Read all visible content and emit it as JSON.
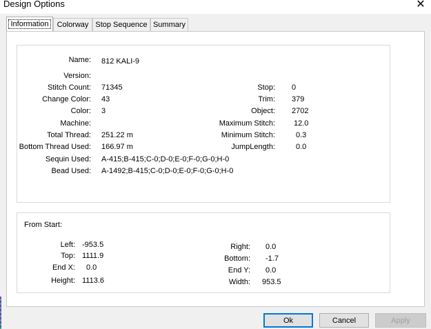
{
  "window": {
    "title": "Design Options",
    "close_glyph": "✕"
  },
  "tabs": [
    {
      "label": "Information",
      "active": true
    },
    {
      "label": "Colorway",
      "active": false
    },
    {
      "label": "Stop Sequence",
      "active": false
    },
    {
      "label": "Summary",
      "active": false
    }
  ],
  "info": {
    "name_label": "Name:",
    "name": "812 KALI-9",
    "version_label": "Version:",
    "version": "",
    "stitch_count_label": "Stitch Count:",
    "stitch_count": "71345",
    "change_color_label": "Change Color:",
    "change_color": "43",
    "color_label": "Color:",
    "color": "3",
    "machine_label": "Machine:",
    "machine": "",
    "total_thread_label": "Total Thread:",
    "total_thread": "251.22 m",
    "bottom_thread_label": "Bottom Thread Used:",
    "bottom_thread": "166.97 m",
    "sequin_label": "Sequin Used:",
    "sequin": "A-415;B-415;C-0;D-0;E-0;F-0;G-0;H-0",
    "bead_label": "Bead Used:",
    "bead": "A-1492;B-415;C-0;D-0;E-0;F-0;G-0;H-0",
    "stop_label": "Stop:",
    "stop": "0",
    "trim_label": "Trim:",
    "trim": "379",
    "object_label": "Object:",
    "object": "2702",
    "max_stitch_label": "Maximum Stitch:",
    "max_stitch": "12.0",
    "min_stitch_label": "Minimum Stitch:",
    "min_stitch": "0.3",
    "jump_length_label": "JumpLength:",
    "jump_length": "0.0"
  },
  "from_start": {
    "heading": "From Start:",
    "left_label": "Left:",
    "left": "-953.5",
    "top_label": "Top:",
    "top": "1111.9",
    "end_x_label": "End X:",
    "end_x": "0.0",
    "height_label": "Height:",
    "height": "1113.6",
    "right_label": "Right:",
    "right": "0.0",
    "bottom_label": "Bottom:",
    "bottom": "-1.7",
    "end_y_label": "End Y:",
    "end_y": "0.0",
    "width_label": "Width:",
    "width": "953.5"
  },
  "buttons": {
    "ok": "Ok",
    "cancel": "Cancel",
    "apply": "Apply"
  }
}
